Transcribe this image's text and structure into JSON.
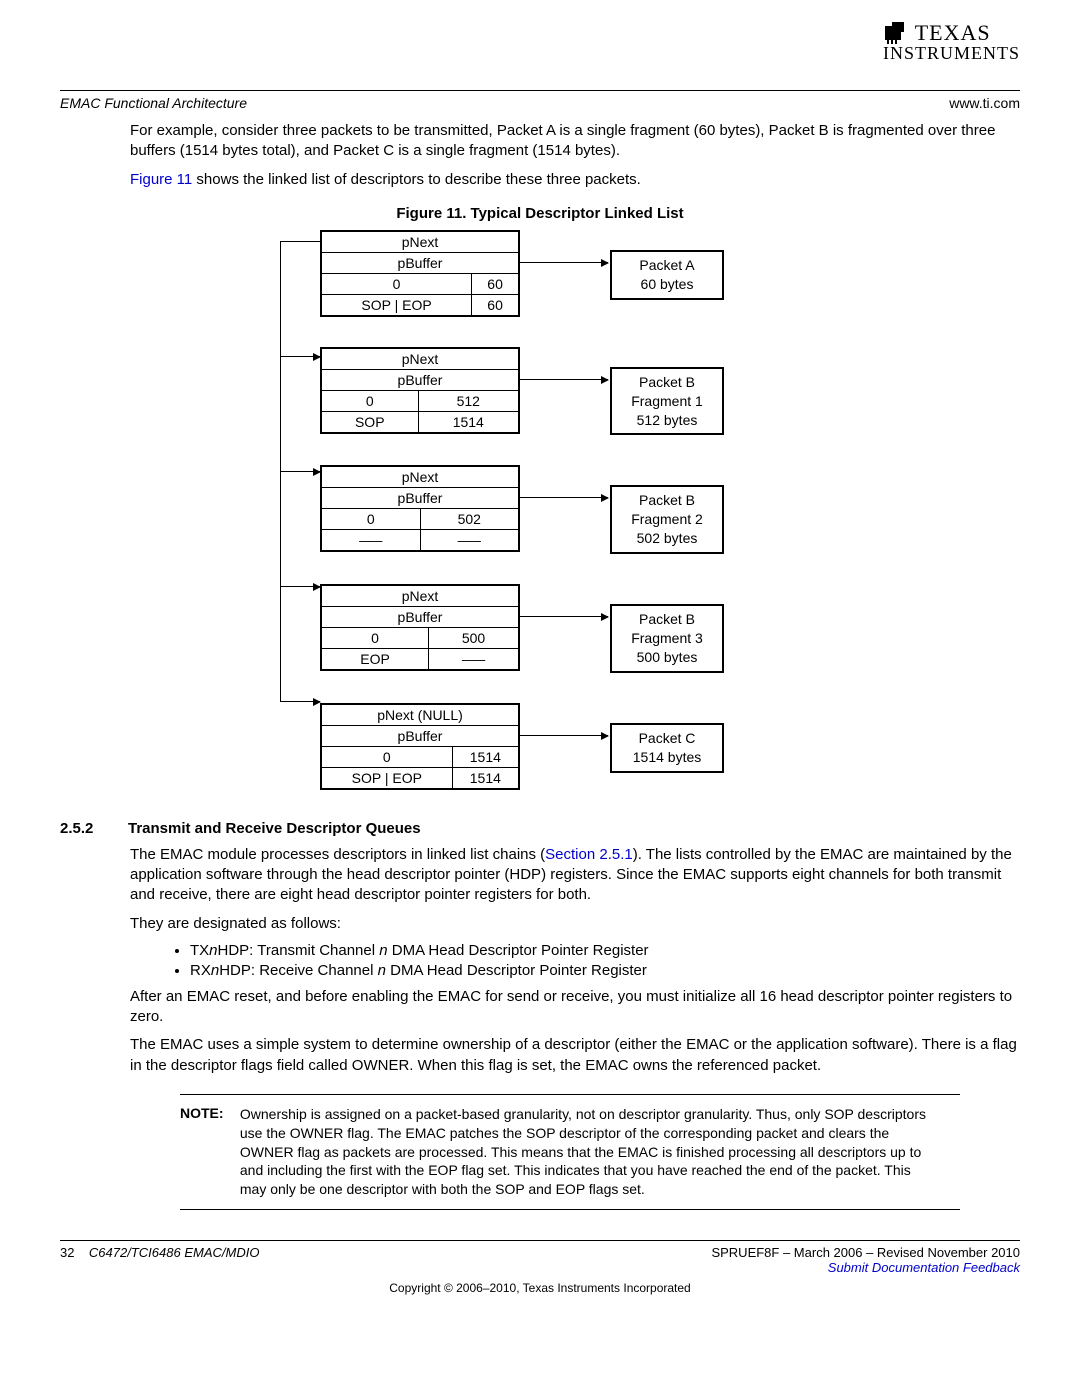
{
  "logo": {
    "top": "TEXAS",
    "bottom": "INSTRUMENTS"
  },
  "header": {
    "left": "EMAC Functional Architecture",
    "right": "www.ti.com"
  },
  "intro": {
    "p1": "For example, consider three packets to be transmitted, Packet A is a single fragment (60 bytes), Packet B is fragmented over three buffers (1514 bytes total), and Packet C is a single fragment (1514 bytes).",
    "p2a": "Figure 11",
    "p2b": " shows the linked list of descriptors to describe these three packets."
  },
  "figure": {
    "caption": "Figure 11. Typical Descriptor Linked List",
    "descs": [
      {
        "pnext": "pNext",
        "pbuffer": "pBuffer",
        "r3a": "0",
        "r3b": "60",
        "r4a": "SOP | EOP",
        "r4b": "60",
        "packet": "Packet A\n60 bytes"
      },
      {
        "pnext": "pNext",
        "pbuffer": "pBuffer",
        "r3a": "0",
        "r3b": "512",
        "r4a": "SOP",
        "r4b": "1514",
        "packet": "Packet B\nFragment 1\n512 bytes"
      },
      {
        "pnext": "pNext",
        "pbuffer": "pBuffer",
        "r3a": "0",
        "r3b": "502",
        "r4a": "–––",
        "r4b": "–––",
        "packet": "Packet B\nFragment 2\n502 bytes"
      },
      {
        "pnext": "pNext",
        "pbuffer": "pBuffer",
        "r3a": "0",
        "r3b": "500",
        "r4a": "EOP",
        "r4b": "–––",
        "packet": "Packet B\nFragment 3\n500 bytes"
      },
      {
        "pnext": "pNext (NULL)",
        "pbuffer": "pBuffer",
        "r3a": "0",
        "r3b": "1514",
        "r4a": "SOP | EOP",
        "r4b": "1514",
        "packet": "Packet C\n1514 bytes"
      }
    ]
  },
  "section": {
    "num": "2.5.2",
    "title": "Transmit and Receive Descriptor Queues",
    "p1a": "The EMAC module processes descriptors in linked list chains (",
    "p1link": "Section 2.5.1",
    "p1b": "). The lists controlled by the EMAC are maintained by the application software through the head descriptor pointer (HDP) registers. Since the EMAC supports eight channels for both transmit and receive, there are eight head descriptor pointer registers for both.",
    "p2": "They are designated as follows:",
    "b1a": "TX",
    "b1n": "n",
    "b1b": "HDP: Transmit Channel ",
    "b1n2": "n",
    "b1c": " DMA Head Descriptor Pointer Register",
    "b2a": "RX",
    "b2n": "n",
    "b2b": "HDP: Receive Channel ",
    "b2n2": "n",
    "b2c": " DMA Head Descriptor Pointer Register",
    "p3": "After an EMAC reset, and before enabling the EMAC for send or receive, you must initialize all 16 head descriptor pointer registers to zero.",
    "p4": "The EMAC uses a simple system to determine ownership of a descriptor (either the EMAC or the application software). There is a flag in the descriptor flags field called OWNER. When this flag is set, the EMAC owns the referenced packet."
  },
  "note": {
    "label": "NOTE:",
    "body": "Ownership is assigned on a packet-based granularity, not on descriptor granularity. Thus, only SOP descriptors use the OWNER flag. The EMAC patches the SOP descriptor of the corresponding packet and clears the OWNER flag as packets are processed. This means that the EMAC is finished processing all descriptors up to and including the first with the EOP flag set. This indicates that you have reached the end of the packet. This may only be one descriptor with both the SOP and EOP flags set."
  },
  "footer": {
    "pagenum": "32",
    "doctitle": "C6472/TCI6486 EMAC/MDIO",
    "docid": "SPRUEF8F – March 2006 – Revised November 2010",
    "feedback": "Submit Documentation Feedback",
    "copyright": "Copyright © 2006–2010, Texas Instruments Incorporated"
  }
}
